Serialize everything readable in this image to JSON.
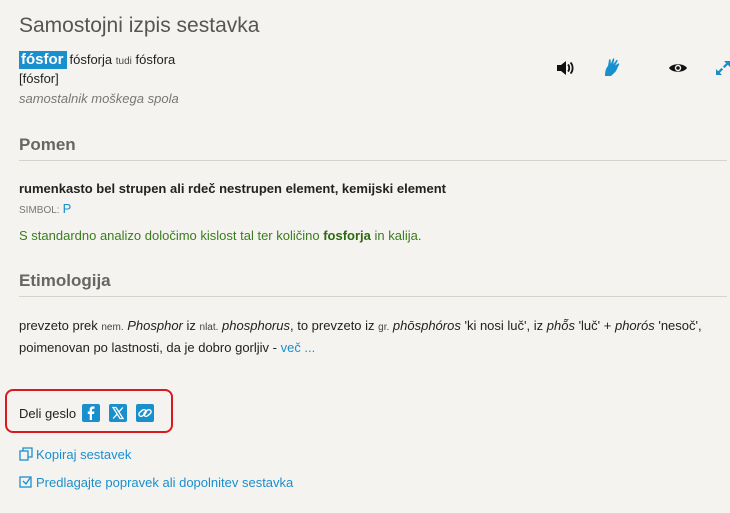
{
  "entry": {
    "page_title": "Samostojni izpis sestavka",
    "headword": "fósfor",
    "genitive": "fósforja",
    "tudi": "tudi",
    "variant": "fósfora",
    "pronunciation": "[fósfor]",
    "part_of_speech": "samostalnik moškega spola"
  },
  "icons": {
    "sound": "speaker-icon",
    "sign": "sign-language-icon",
    "view": "eye-icon",
    "expand": "expand-icon",
    "accent": "#1a8fce"
  },
  "meaning": {
    "heading": "Pomen",
    "definition": "rumenkasto bel strupen ali rdeč nestrupen element, kemijski element",
    "symbol_label": "SIMBOL:",
    "symbol_value": "P",
    "example_before": "S standardno analizo določimo kislost tal ter količino ",
    "example_bold": "fosforja",
    "example_after": " in kalija."
  },
  "etymology": {
    "heading": "Etimologija",
    "t1": "prevzeto prek ",
    "l1": "nem.",
    "w1": "Phosphor",
    "t2": " iz ",
    "l2": "nlat.",
    "w2": "phosphorus",
    "t3": ", to prevzeto iz ",
    "l3": "gr.",
    "w3": "phōsphóros",
    "t4": " 'ki nosi luč', iz ",
    "w4": "phō̃s",
    "t5": " 'luč' + ",
    "w5": "phorós",
    "t6": " 'nesoč', poimenovan po lastnosti, da je dobro gorljiv - ",
    "more": "več ..."
  },
  "share": {
    "label": "Deli geslo",
    "facebook": "facebook-icon",
    "x": "x-icon",
    "link": "link-icon",
    "highlight": "#d9181f"
  },
  "actions": {
    "copy": "Kopiraj sestavek",
    "suggest": "Predlagajte popravek ali dopolnitev sestavka"
  }
}
